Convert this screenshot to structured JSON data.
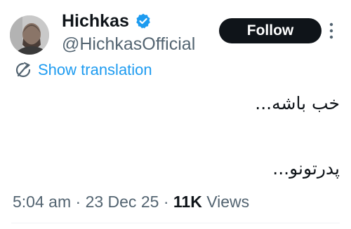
{
  "author": {
    "display_name": "Hichkas",
    "handle": "@HichkasOfficial",
    "verified": true,
    "verified_icon": "verified-badge-icon",
    "avatar": "profile-photo"
  },
  "actions": {
    "follow_label": "Follow",
    "more_icon": "more-vertical-icon"
  },
  "translation": {
    "label": "Show translation",
    "icon": "translate-icon"
  },
  "tweet": {
    "lines": [
      "خب باشه...",
      "پدرتونو..."
    ]
  },
  "meta": {
    "time": "5:04 am",
    "separator": "·",
    "date": "23 Dec 25",
    "views_count": "11K",
    "views_label": "Views"
  },
  "colors": {
    "accent": "#1d9bf0",
    "text": "#0f1419",
    "secondary": "#536471",
    "follow_bg": "#0f1419"
  }
}
